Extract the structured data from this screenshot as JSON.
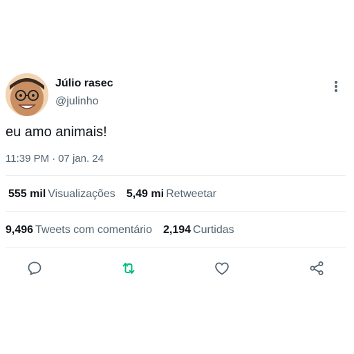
{
  "tweet": {
    "author_name": "Júlio rasec",
    "author_handle": "@julinho",
    "text": "eu amo animais!",
    "time": "11:39 PM",
    "date": "07 jan. 24",
    "separator": "·"
  },
  "stats_row_1": [
    {
      "value": "555 mil",
      "label": "Visualizações"
    },
    {
      "value": "5,49 mi",
      "label": "Retweetar"
    }
  ],
  "stats_row_2": [
    {
      "value": "9,496",
      "label": "Tweets com comentário"
    },
    {
      "value": "2,194",
      "label": "Curtidas"
    }
  ],
  "actions": [
    "reply-icon",
    "retweet-icon",
    "like-icon",
    "share-icon"
  ],
  "colors": {
    "text": "#0f1419",
    "secondary": "#536471",
    "retweet_active": "#00ba7c",
    "divider": "#e6e9ec"
  }
}
